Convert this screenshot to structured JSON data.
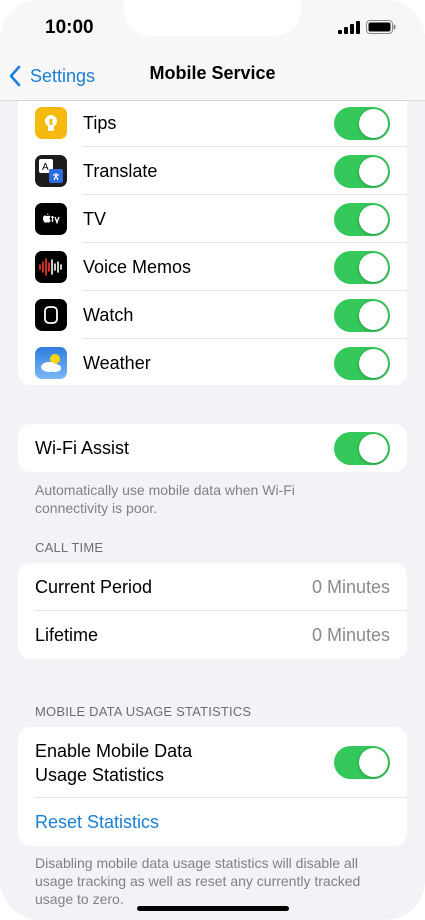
{
  "status_bar": {
    "time": "10:00"
  },
  "nav": {
    "back_label": "Settings",
    "title": "Mobile Service"
  },
  "apps": [
    {
      "name": "Tips",
      "icon": "tips-icon",
      "enabled": true
    },
    {
      "name": "Translate",
      "icon": "translate-icon",
      "enabled": true
    },
    {
      "name": "TV",
      "icon": "apple-tv-icon",
      "enabled": true
    },
    {
      "name": "Voice Memos",
      "icon": "voice-memos-icon",
      "enabled": true
    },
    {
      "name": "Watch",
      "icon": "watch-icon",
      "enabled": true
    },
    {
      "name": "Weather",
      "icon": "weather-icon",
      "enabled": true
    }
  ],
  "wifi_assist": {
    "label": "Wi-Fi Assist",
    "enabled": true,
    "footer": "Automatically use mobile data when Wi-Fi connectivity is poor."
  },
  "call_time": {
    "header": "CALL TIME",
    "rows": [
      {
        "label": "Current Period",
        "value": "0 Minutes"
      },
      {
        "label": "Lifetime",
        "value": "0 Minutes"
      }
    ]
  },
  "usage_stats": {
    "header": "MOBILE DATA USAGE STATISTICS",
    "enable_label_line1": "Enable Mobile Data",
    "enable_label_line2": "Usage Statistics",
    "enabled": true,
    "reset_label": "Reset Statistics",
    "footer": "Disabling mobile data usage statistics will disable all usage tracking as well as reset any currently tracked usage to zero."
  },
  "colors": {
    "accent": "#1a7fd6",
    "toggle_on": "#34c759",
    "background": "#f2f2f7"
  }
}
